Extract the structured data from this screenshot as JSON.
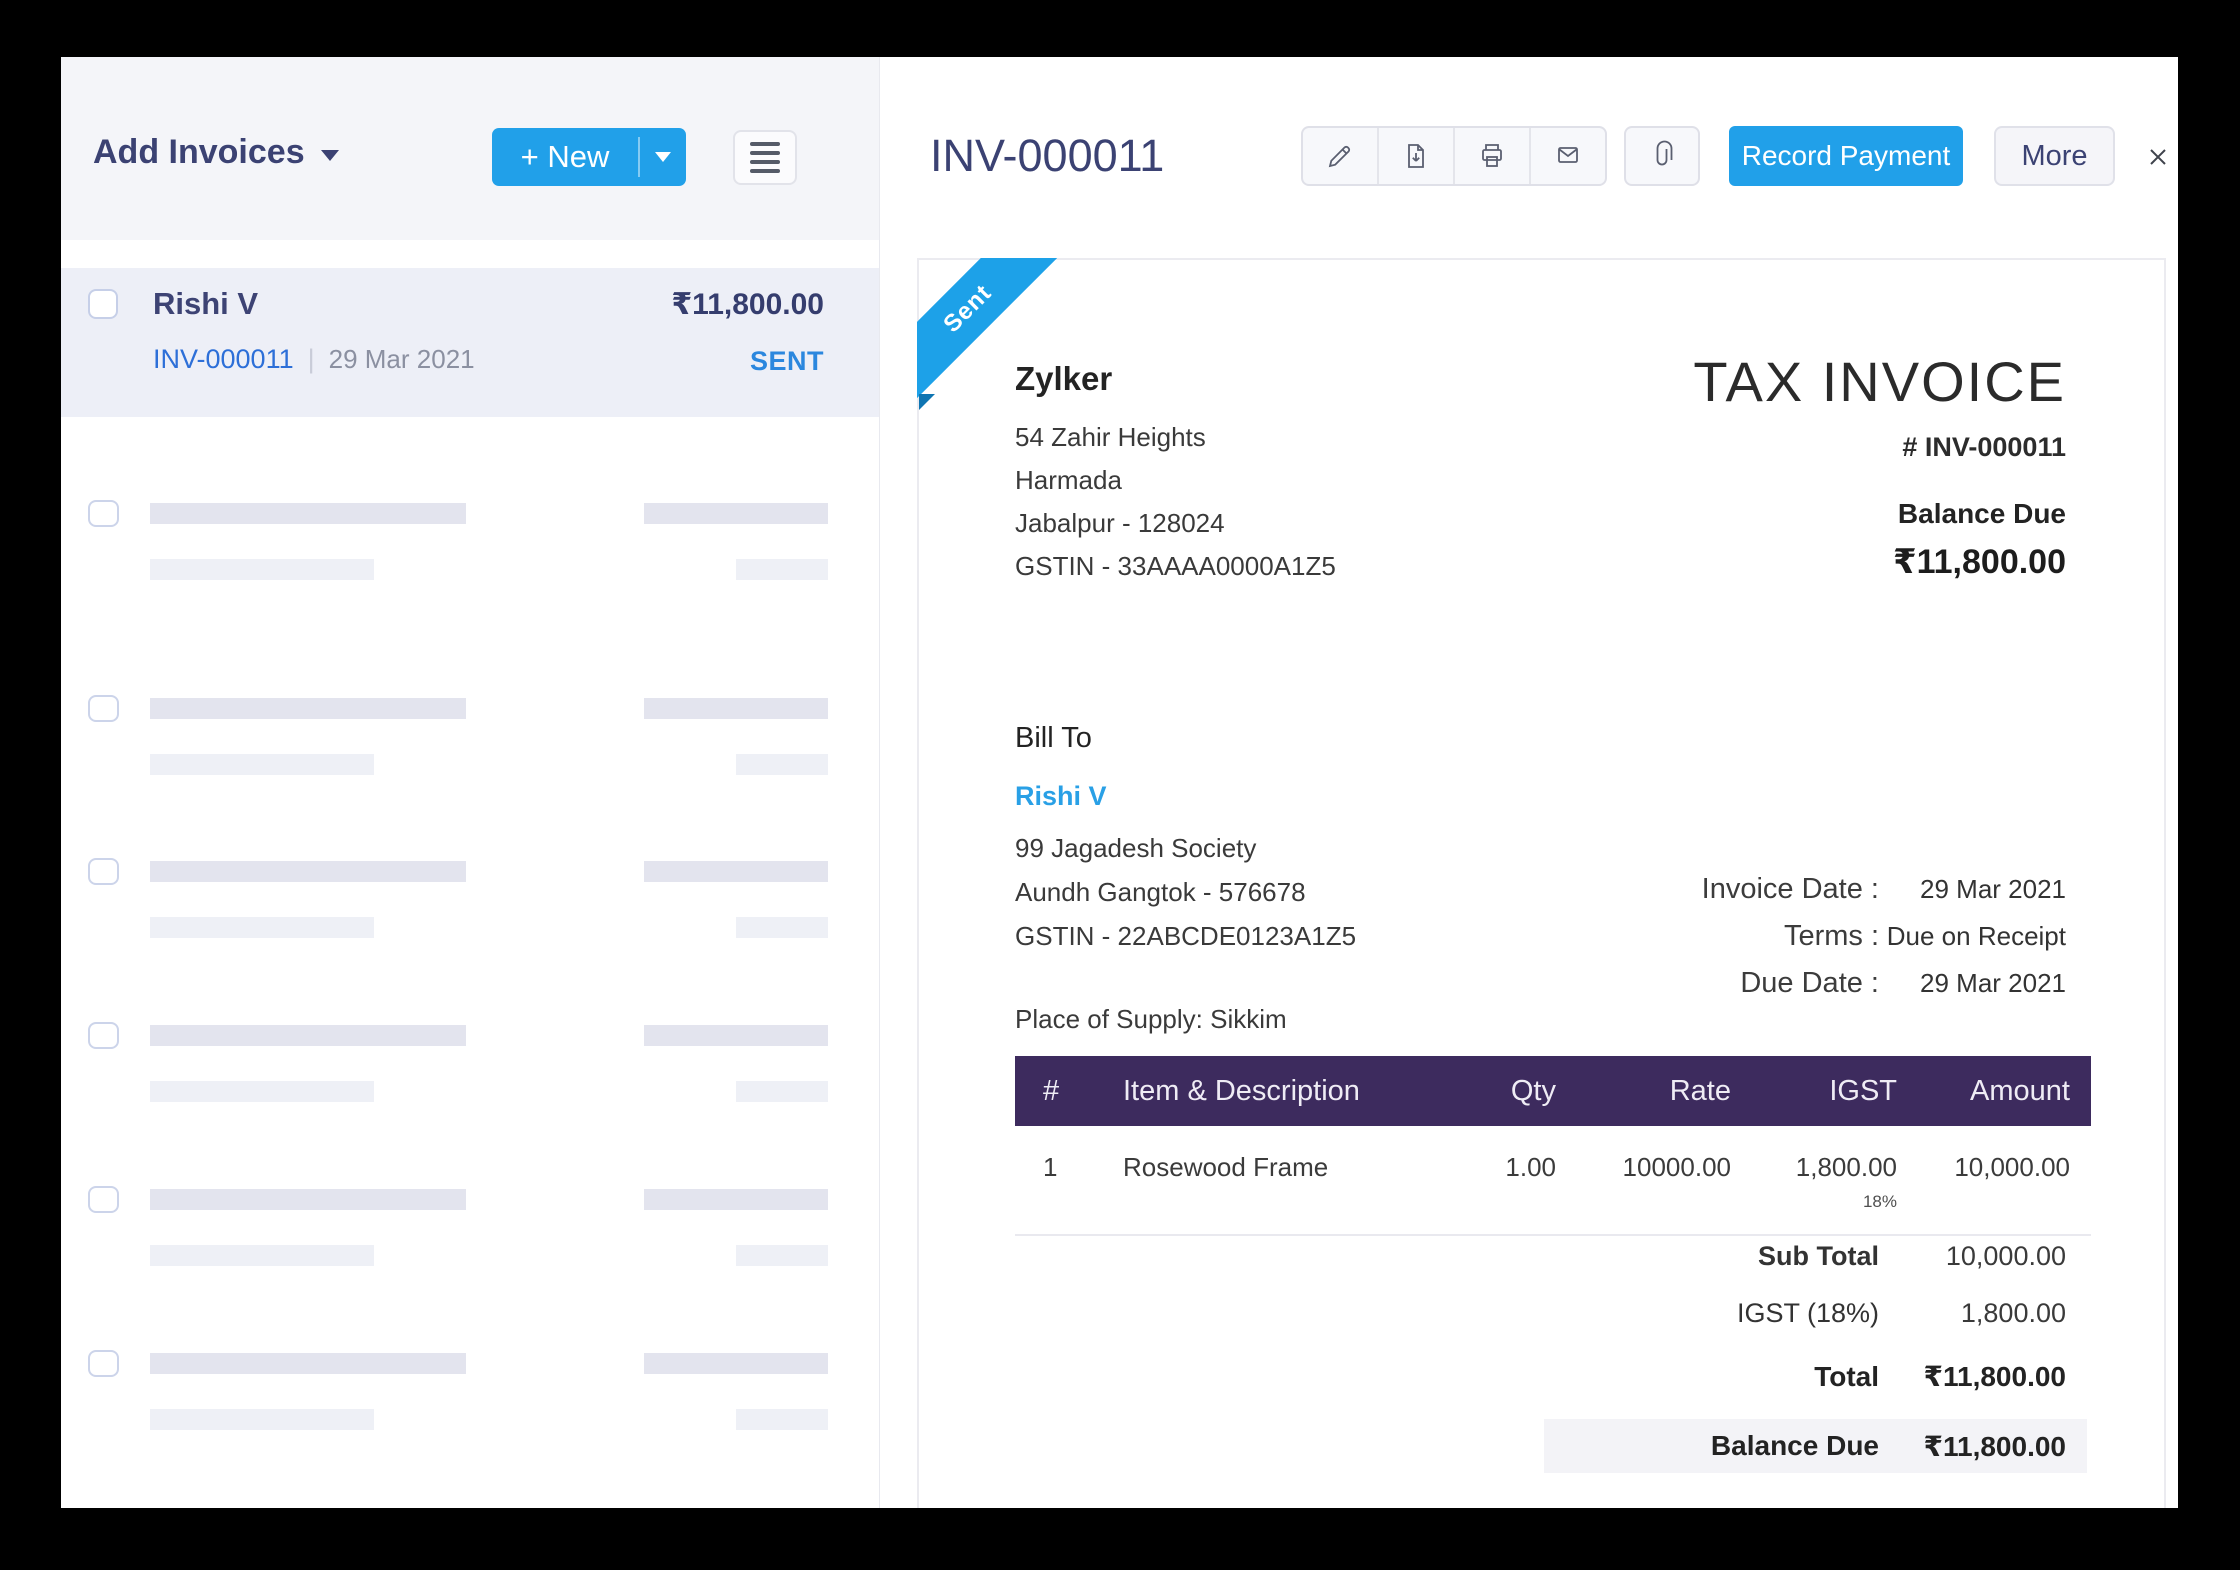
{
  "left_panel": {
    "title": "Add Invoices",
    "new_button_label": "+ New",
    "invoice": {
      "customer": "Rishi V",
      "amount": "₹11,800.00",
      "number": "INV-000011",
      "separator": "|",
      "date": "29 Mar 2021",
      "status": "SENT"
    },
    "skeleton_rows": 6
  },
  "detail_header": {
    "title": "INV-000011",
    "record_payment_label": "Record Payment",
    "more_label": "More"
  },
  "invoice_doc": {
    "ribbon": "Sent",
    "company": {
      "name": "Zylker",
      "address": [
        "54 Zahir Heights",
        "Harmada",
        "Jabalpur - 128024",
        "GSTIN - 33AAAA0000A1Z5"
      ]
    },
    "doc_title": "TAX INVOICE",
    "doc_number": "# INV-000011",
    "balance_due_label": "Balance Due",
    "balance_due_value": "₹11,800.00",
    "bill_to": {
      "label": "Bill To",
      "name": "Rishi V",
      "address": [
        "99 Jagadesh Society",
        "Aundh Gangtok - 576678",
        "GSTIN - 22ABCDE0123A1Z5"
      ],
      "place_of_supply": "Place of Supply: Sikkim"
    },
    "meta": [
      {
        "label": "Invoice Date :",
        "value": "29 Mar 2021"
      },
      {
        "label": "Terms :",
        "value": "Due on Receipt"
      },
      {
        "label": "Due Date :",
        "value": "29 Mar 2021"
      }
    ],
    "table": {
      "headers": [
        "#",
        "Item & Description",
        "Qty",
        "Rate",
        "IGST",
        "Amount"
      ],
      "rows": [
        {
          "num": "1",
          "desc": "Rosewood Frame",
          "qty": "1.00",
          "rate": "10000.00",
          "igst": "1,800.00",
          "igst_sub": "18%",
          "amount": "10,000.00"
        }
      ]
    },
    "totals": [
      {
        "label": "Sub Total",
        "value": "10,000.00"
      },
      {
        "label": "IGST (18%)",
        "value": "1,800.00"
      },
      {
        "label": "Total",
        "value": "₹11,800.00"
      },
      {
        "label": "Balance Due",
        "value": "₹11,800.00"
      }
    ]
  },
  "colors": {
    "accent_blue": "#21a0e9",
    "ribbon_blue": "#1da1e8",
    "table_header_purple": "#3d2b5e",
    "invoice_link_blue": "#2d6fd8",
    "status_blue": "#2b87de",
    "navy_text": "#3b4273",
    "panel_header_bg": "#f4f5f9",
    "selected_row_bg": "#edeff7",
    "highlight_row_bg": "#f3f3f7"
  }
}
